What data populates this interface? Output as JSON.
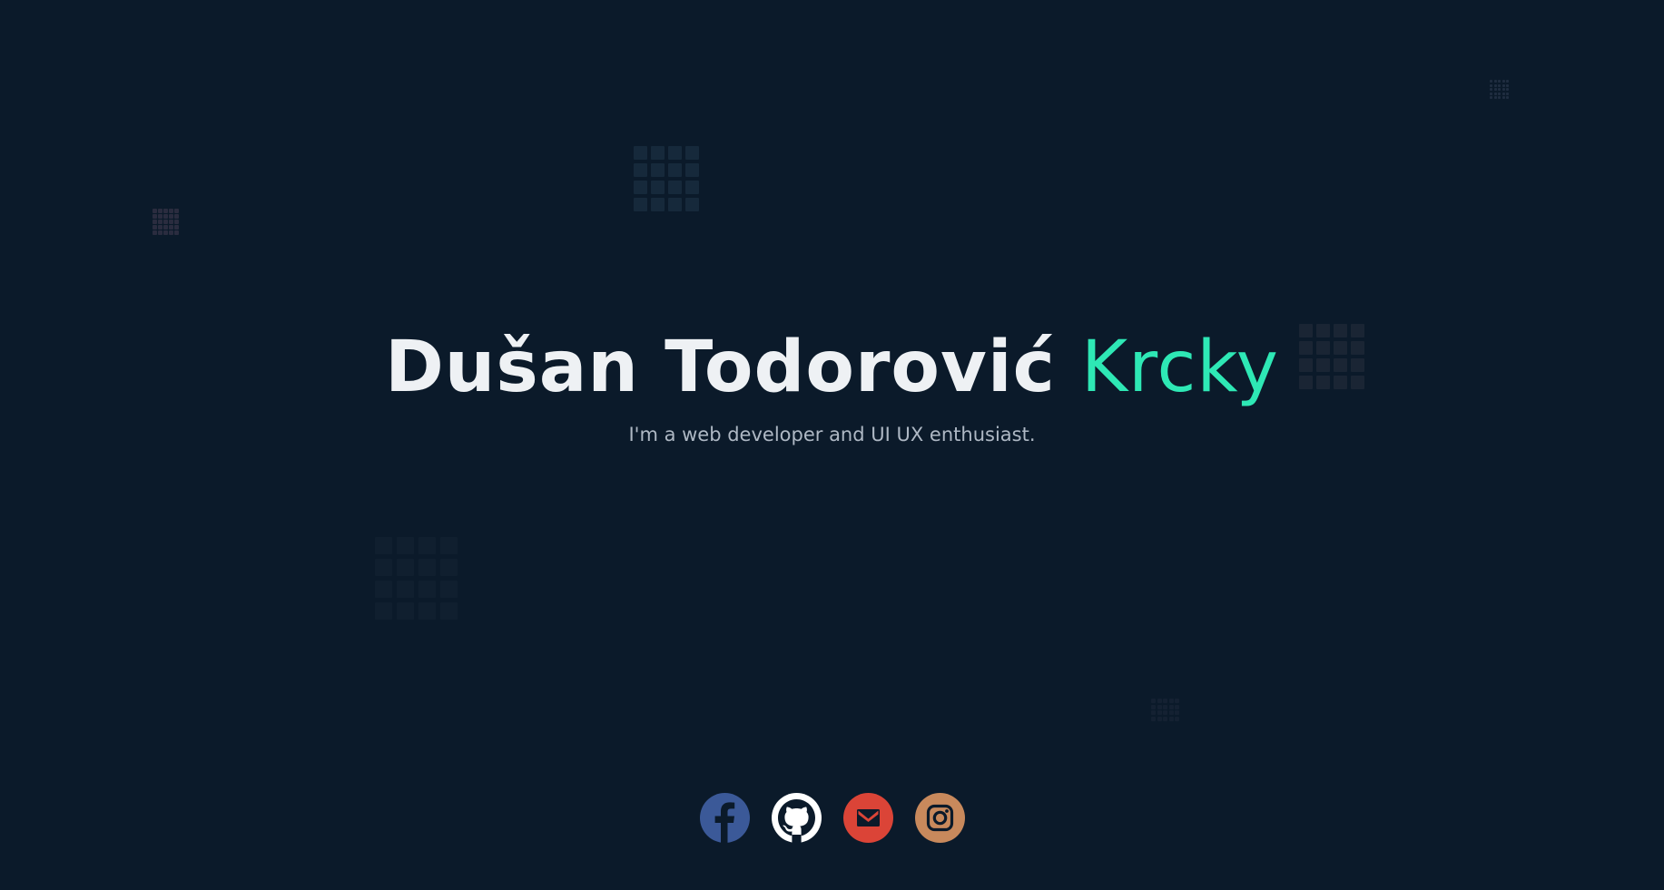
{
  "hero": {
    "name": "Dušan Todorović",
    "nickname": "Krcky",
    "tagline": "I'm a web developer and UI UX enthusiast."
  },
  "colors": {
    "background": "#0b1a2a",
    "name": "#eef1f4",
    "nickname": "#2ee8b5",
    "tagline": "#aeb8c4",
    "facebook": "#3b5998",
    "github": "#ffffff",
    "gmail": "#db4437",
    "instagram": "#c8895c"
  },
  "socials": [
    {
      "icon": "facebook-icon"
    },
    {
      "icon": "github-icon"
    },
    {
      "icon": "gmail-icon"
    },
    {
      "icon": "instagram-icon"
    }
  ]
}
